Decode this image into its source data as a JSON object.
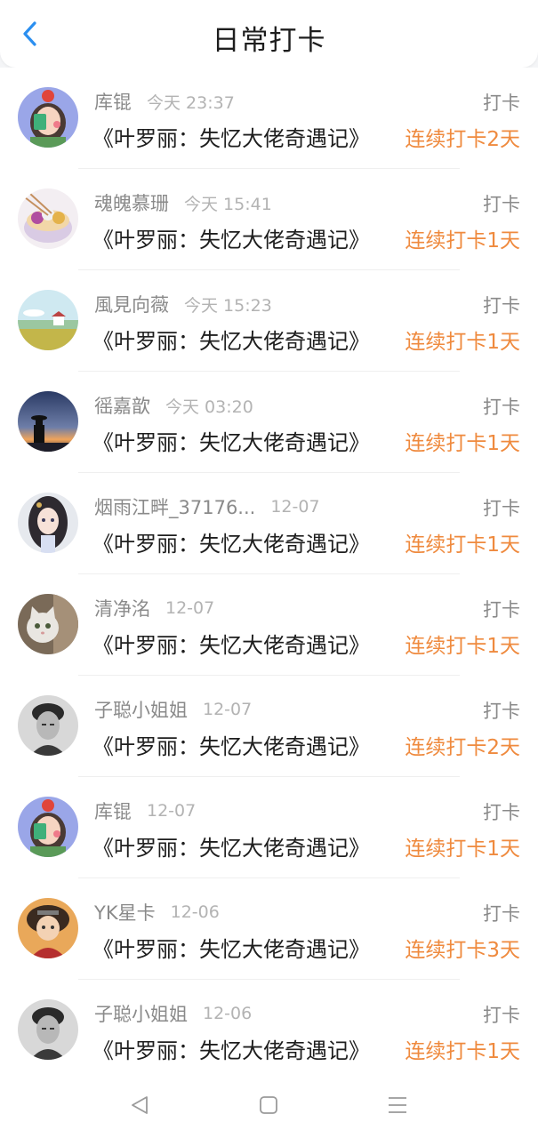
{
  "header": {
    "title": "日常打卡",
    "back_icon": "chevron-left-icon",
    "accent": "#2b8ff0"
  },
  "items": [
    {
      "username": "库锟",
      "time": "今天 23:37",
      "action": "打卡",
      "book": "《叶罗丽：失忆大佬奇遇记》",
      "streak": "连续打卡2天",
      "avatar": "girl-cartoon"
    },
    {
      "username": "魂魄慕珊",
      "time": "今天 15:41",
      "action": "打卡",
      "book": "《叶罗丽：失忆大佬奇遇记》",
      "streak": "连续打卡1天",
      "avatar": "food-bowl"
    },
    {
      "username": "風見向薇",
      "time": "今天 15:23",
      "action": "打卡",
      "book": "《叶罗丽：失忆大佬奇遇记》",
      "streak": "连续打卡1天",
      "avatar": "landscape"
    },
    {
      "username": "徭嘉歆",
      "time": "今天 03:20",
      "action": "打卡",
      "book": "《叶罗丽：失忆大佬奇遇记》",
      "streak": "连续打卡1天",
      "avatar": "sunset-silhouette"
    },
    {
      "username": "烟雨江畔_37176...",
      "time": "12-07",
      "action": "打卡",
      "book": "《叶罗丽：失忆大佬奇遇记》",
      "streak": "连续打卡1天",
      "avatar": "anime-woman"
    },
    {
      "username": "清净洺",
      "time": "12-07",
      "action": "打卡",
      "book": "《叶罗丽：失忆大佬奇遇记》",
      "streak": "连续打卡1天",
      "avatar": "cat"
    },
    {
      "username": "子聪小姐姐",
      "time": "12-07",
      "action": "打卡",
      "book": "《叶罗丽：失忆大佬奇遇记》",
      "streak": "连续打卡2天",
      "avatar": "man-bw"
    },
    {
      "username": "库锟",
      "time": "12-07",
      "action": "打卡",
      "book": "《叶罗丽：失忆大佬奇遇记》",
      "streak": "连续打卡1天",
      "avatar": "girl-cartoon"
    },
    {
      "username": "YK星卡",
      "time": "12-06",
      "action": "打卡",
      "book": "《叶罗丽：失忆大佬奇遇记》",
      "streak": "连续打卡3天",
      "avatar": "anime-boy"
    },
    {
      "username": "子聪小姐姐",
      "time": "12-06",
      "action": "打卡",
      "book": "《叶罗丽：失忆大佬奇遇记》",
      "streak": "连续打卡1天",
      "avatar": "man-bw"
    }
  ],
  "colors": {
    "streak": "#ef8a3e",
    "username": "#8a8a8a",
    "time": "#b3b3b3"
  },
  "navbar": {
    "back_icon": "nav-back-icon",
    "home_icon": "nav-home-icon",
    "menu_icon": "nav-menu-icon"
  }
}
